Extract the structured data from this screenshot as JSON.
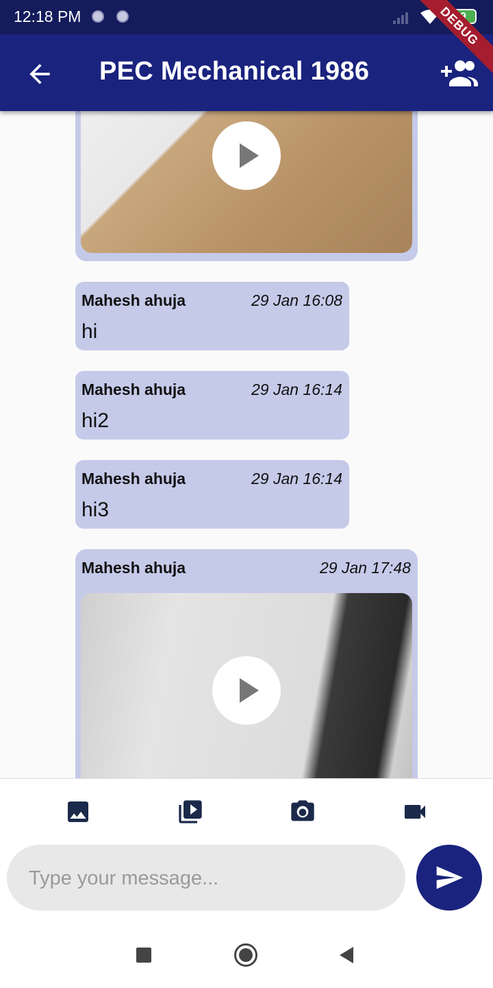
{
  "status_bar": {
    "time": "12:18 PM",
    "battery": "89",
    "debug_banner": "DEBUG"
  },
  "app_bar": {
    "title": "PEC Mechanical 1986",
    "back_icon": "arrow-back-icon",
    "action_icon": "add-group-icon"
  },
  "messages": [
    {
      "type": "video",
      "sender": "",
      "time": ""
    },
    {
      "type": "text",
      "sender": "Mahesh ahuja",
      "time": "29 Jan 16:08",
      "text": "hi"
    },
    {
      "type": "text",
      "sender": "Mahesh ahuja",
      "time": "29 Jan 16:14",
      "text": "hi2"
    },
    {
      "type": "text",
      "sender": "Mahesh ahuja",
      "time": "29 Jan 16:14",
      "text": "hi3"
    },
    {
      "type": "video",
      "sender": "Mahesh ahuja",
      "time": "29 Jan 17:48"
    }
  ],
  "toolbar": [
    "image-icon",
    "video-library-icon",
    "camera-icon",
    "videocam-icon"
  ],
  "composer": {
    "placeholder": "Type your message...",
    "value": "",
    "send_icon": "send-icon"
  },
  "navigation": [
    "recents-square-icon",
    "home-circle-icon",
    "back-triangle-icon"
  ],
  "colors": {
    "appbar": "#1a237e",
    "status_bar": "#141c5c",
    "bubble": "#c5cae9",
    "send_button": "#1a237e"
  }
}
